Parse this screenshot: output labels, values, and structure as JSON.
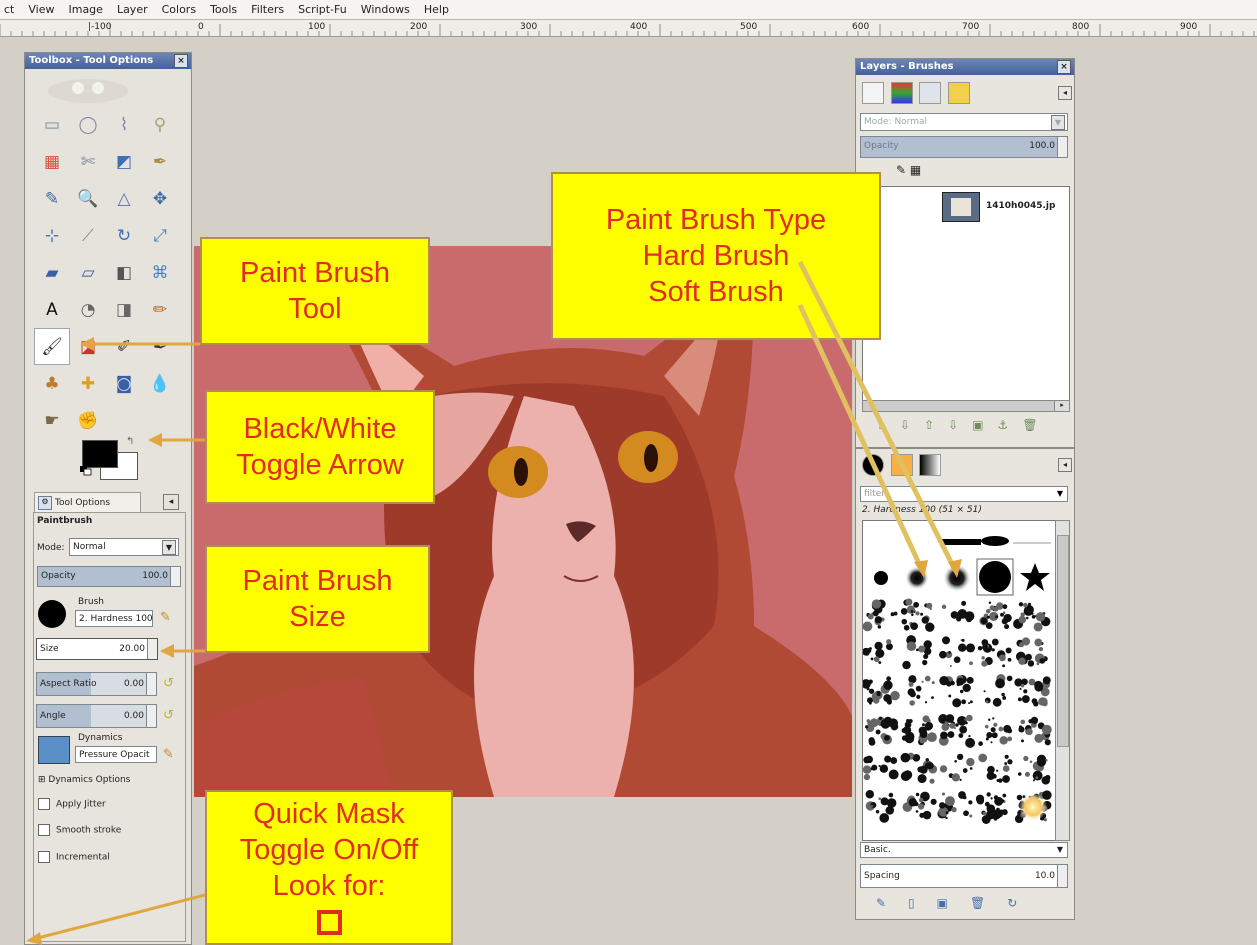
{
  "menu": [
    "ct",
    "View",
    "Image",
    "Layer",
    "Colors",
    "Tools",
    "Filters",
    "Script-Fu",
    "Windows",
    "Help"
  ],
  "ruler": [
    "|-100",
    "0",
    "100",
    "200",
    "300",
    "400",
    "500",
    "600",
    "700",
    "800",
    "900"
  ],
  "toolbox": {
    "title": "Toolbox - Tool Options",
    "tools": [
      {
        "icon": "rect-select-icon",
        "glyph": "▭"
      },
      {
        "icon": "ellipse-select-icon",
        "glyph": "◯"
      },
      {
        "icon": "free-select-icon",
        "glyph": "⌇"
      },
      {
        "icon": "fuzzy-select-icon",
        "glyph": "⚲"
      },
      {
        "icon": "color-select-icon",
        "glyph": "▦"
      },
      {
        "icon": "scissors-select-icon",
        "glyph": "✄"
      },
      {
        "icon": "foreground-select-icon",
        "glyph": "◩"
      },
      {
        "icon": "paths-icon",
        "glyph": "✒"
      },
      {
        "icon": "color-picker-icon",
        "glyph": "✎"
      },
      {
        "icon": "zoom-icon",
        "glyph": "🔍"
      },
      {
        "icon": "measure-icon",
        "glyph": "△"
      },
      {
        "icon": "move-icon",
        "glyph": "✥"
      },
      {
        "icon": "align-icon",
        "glyph": "⊹"
      },
      {
        "icon": "crop-icon",
        "glyph": "⟋"
      },
      {
        "icon": "rotate-icon",
        "glyph": "↻"
      },
      {
        "icon": "scale-icon",
        "glyph": "⤢"
      },
      {
        "icon": "shear-icon",
        "glyph": "▰"
      },
      {
        "icon": "perspective-icon",
        "glyph": "▱"
      },
      {
        "icon": "flip-icon",
        "glyph": "◧"
      },
      {
        "icon": "cage-icon",
        "glyph": "⌘"
      },
      {
        "icon": "text-icon",
        "glyph": "A"
      },
      {
        "icon": "bucket-fill-icon",
        "glyph": "◔"
      },
      {
        "icon": "blend-icon",
        "glyph": "◨"
      },
      {
        "icon": "pencil-icon",
        "glyph": "✏"
      },
      {
        "icon": "paintbrush-icon",
        "glyph": "🖌"
      },
      {
        "icon": "eraser-icon",
        "glyph": "◪"
      },
      {
        "icon": "airbrush-icon",
        "glyph": "✐"
      },
      {
        "icon": "ink-icon",
        "glyph": "✒"
      },
      {
        "icon": "clone-icon",
        "glyph": "♣"
      },
      {
        "icon": "heal-icon",
        "glyph": "✚"
      },
      {
        "icon": "perspective-clone-icon",
        "glyph": "◙"
      },
      {
        "icon": "blur-icon",
        "glyph": "💧"
      },
      {
        "icon": "smudge-icon",
        "glyph": "☛"
      },
      {
        "icon": "dodge-burn-icon",
        "glyph": "✊"
      }
    ],
    "tool_options_tab": "Tool Options",
    "tool_name": "Paintbrush",
    "mode_label": "Mode:",
    "mode_value": "Normal",
    "opacity_label": "Opacity",
    "opacity_value": "100.0",
    "opacity_fraction": 1.0,
    "brush_label": "Brush",
    "brush_value": "2. Hardness 100",
    "size_label": "Size",
    "size_value": "20.00",
    "aspect_label": "Aspect Ratio",
    "aspect_value": "0.00",
    "angle_label": "Angle",
    "angle_value": "0.00",
    "dynamics_label": "Dynamics",
    "dynamics_value": "Pressure Opacit",
    "dynamics_options": "Dynamics Options",
    "apply_jitter": "Apply Jitter",
    "smooth_stroke": "Smooth stroke",
    "incremental": "Incremental"
  },
  "layers": {
    "title": "Layers - Brushes",
    "mode_label": "Mode:",
    "mode_value": "Normal",
    "opacity_label": "Opacity",
    "opacity_value": "100.0",
    "layer_name": "1410h0045.jp"
  },
  "brushes": {
    "filter_placeholder": "filter",
    "brush_title": "2. Hardness 100 (51 × 51)",
    "preset": "Basic.",
    "spacing_label": "Spacing",
    "spacing_value": "10.0"
  },
  "callouts": {
    "paint_brush_tool": [
      "Paint Brush",
      "Tool"
    ],
    "black_white": [
      "Black/White",
      "Toggle Arrow"
    ],
    "brush_size": [
      "Paint Brush",
      "Size"
    ],
    "quick_mask": [
      "Quick Mask",
      "Toggle On/Off",
      "Look for:"
    ],
    "brush_type": [
      "Paint Brush Type",
      "Hard Brush",
      "Soft Brush"
    ]
  },
  "colors": {
    "callout_bg": "#ffff00",
    "callout_text": "#e02d1f",
    "arrow": "#e0a640",
    "mask_overlay": "#c76a6a"
  }
}
